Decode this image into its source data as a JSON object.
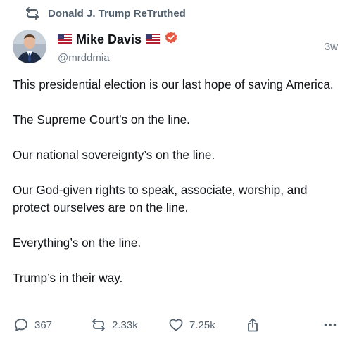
{
  "retruth": {
    "icon": "retruth-icon",
    "label": "Donald J. Trump ReTruthed"
  },
  "author": {
    "display_name": "Mike Davis",
    "handle": "@mrddmia",
    "verified": true,
    "verified_color": "#e8573f",
    "flag_icon": "us-flag-icon",
    "avatar": "avatar"
  },
  "post": {
    "time": "3w",
    "paragraphs": [
      "This presidential election is our last hope of saving America.",
      "The Supreme Court’s on the line.",
      "Our national sovereignty’s on the line.",
      "Our God-given rights to speak, associate, worship, and protect ourselves are on the line.",
      "Everything’s on the line.",
      "Trump’s in their way."
    ]
  },
  "actions": {
    "replies": "367",
    "retruths": "2.33k",
    "likes": "7.25k"
  },
  "colors": {
    "text": "#111418",
    "muted": "#6b7785",
    "icon": "#52606d"
  }
}
